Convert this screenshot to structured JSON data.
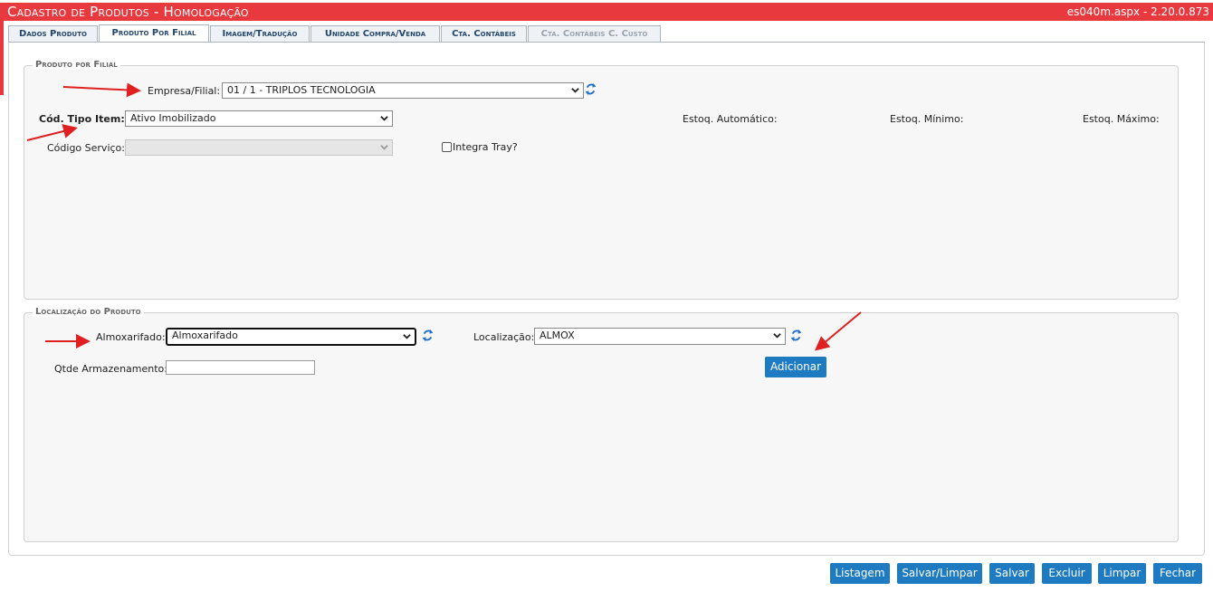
{
  "header": {
    "title": "Cadastro de Produtos  - Homologação",
    "version": "es040m.aspx - 2.20.0.873"
  },
  "tabs": [
    {
      "label": "Dados Produto",
      "state": "normal"
    },
    {
      "label": "Produto Por Filial",
      "state": "active"
    },
    {
      "label": "Imagem/Tradução",
      "state": "normal"
    },
    {
      "label": "Unidade Compra/Venda",
      "state": "normal"
    },
    {
      "label": "Cta. Contábeis",
      "state": "normal"
    },
    {
      "label": "Cta. Contábeis C. Custo",
      "state": "disabled"
    }
  ],
  "filial_section": {
    "legend": "Produto por Filial",
    "empresa_label": "Empresa/Filial:",
    "empresa_value": "01 / 1 - TRIPLOS TECNOLOGIA",
    "tipo_item_label": "Cód. Tipo Item:",
    "tipo_item_value": "Ativo Imobilizado",
    "codigo_servico_label": "Código Serviço:",
    "codigo_servico_value": "",
    "integra_tray_label": "Integra Tray?",
    "integra_tray_checked": false,
    "estoq_automatico_label": "Estoq. Automático:",
    "estoq_minimo_label": "Estoq. Mínimo:",
    "estoq_maximo_label": "Estoq. Máximo:"
  },
  "localizacao_section": {
    "legend": "Localização do Produto",
    "almoxarifado_label": "Almoxarifado:",
    "almoxarifado_value": "Almoxarifado",
    "localizacao_label": "Localização:",
    "localizacao_value": "ALMOX",
    "qtde_label": "Qtde Armazenamento:",
    "qtde_value": "",
    "adicionar_label": "Adicionar"
  },
  "footer_buttons": {
    "listagem": "Listagem",
    "salvar_limpar": "Salvar/Limpar",
    "salvar": "Salvar",
    "excluir": "Excluir",
    "limpar": "Limpar",
    "fechar": "Fechar"
  },
  "colors": {
    "header_bg": "#e8393f",
    "button_bg": "#1e7ac1",
    "annotation_arrow": "#e02020"
  }
}
